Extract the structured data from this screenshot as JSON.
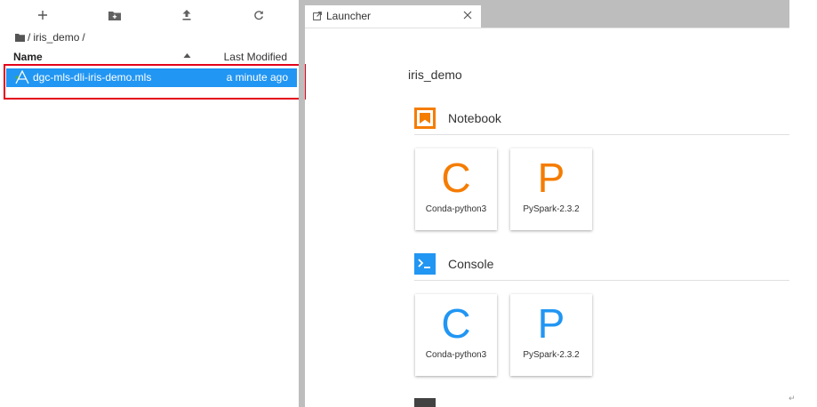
{
  "file_browser": {
    "breadcrumb": [
      "/",
      "iris_demo",
      "/"
    ],
    "columns": {
      "name": "Name",
      "modified": "Last Modified"
    },
    "files": [
      {
        "name": "dgc-mls-dli-iris-demo.mls",
        "modified": "a minute ago"
      }
    ]
  },
  "tabs": [
    {
      "label": "Launcher"
    }
  ],
  "launcher": {
    "title": "iris_demo",
    "sections": [
      {
        "title": "Notebook",
        "icon": "notebook-icon",
        "color": "#f57c00",
        "cards": [
          {
            "letter": "C",
            "label": "Conda-python3"
          },
          {
            "letter": "P",
            "label": "PySpark-2.3.2"
          }
        ]
      },
      {
        "title": "Console",
        "icon": "console-icon",
        "color": "#2196f3",
        "cards": [
          {
            "letter": "C",
            "label": "Conda-python3"
          },
          {
            "letter": "P",
            "label": "PySpark-2.3.2"
          }
        ]
      }
    ]
  },
  "icons": {
    "toolbar": [
      "plus-icon",
      "new-folder-icon",
      "upload-icon",
      "refresh-icon"
    ],
    "folder": "folder-icon",
    "file": "mls-file-icon",
    "tab": "launcher-tab-icon",
    "close": "close-icon"
  },
  "colors": {
    "selection": "#2196f3",
    "highlight_box": "#e3001b",
    "notebook": "#f57c00",
    "console": "#2196f3"
  }
}
